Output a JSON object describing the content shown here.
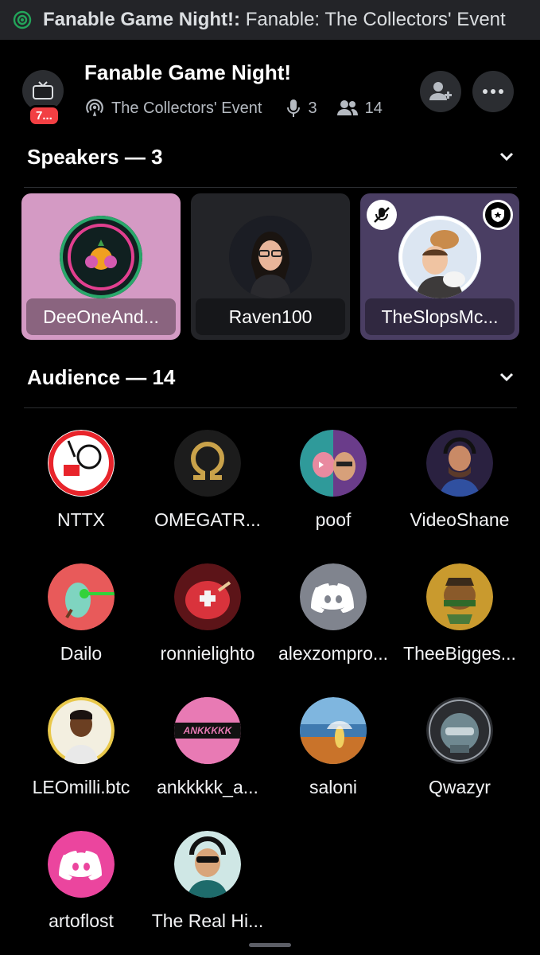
{
  "status_bar": {
    "bold_part": "Fanable Game Night!:",
    "rest": " Fanable: The Collectors' Event",
    "icon": "stage-broadcast-icon"
  },
  "header": {
    "badge": "7...",
    "title": "Fanable Game Night!",
    "subtitle": "The Collectors' Event",
    "speaker_count": "3",
    "listener_count": "14",
    "invite_icon": "add-person-icon",
    "more_icon": "ellipsis-icon"
  },
  "speakers": {
    "label": "Speakers — 3",
    "items": [
      {
        "name": "DeeOneAnd..."
      },
      {
        "name": "Raven100"
      },
      {
        "name": "TheSlopsMc..."
      }
    ]
  },
  "audience": {
    "label": "Audience — 14",
    "items": [
      {
        "name": "NTTX"
      },
      {
        "name": "OMEGATR..."
      },
      {
        "name": "poof"
      },
      {
        "name": "VideoShane"
      },
      {
        "name": "Dailo"
      },
      {
        "name": "ronnielighto"
      },
      {
        "name": "alexzompro..."
      },
      {
        "name": "TheeBigges..."
      },
      {
        "name": "LEOmilli.btc"
      },
      {
        "name": "ankkkkk_a..."
      },
      {
        "name": "saloni"
      },
      {
        "name": "Qwazyr"
      },
      {
        "name": "artoflost"
      },
      {
        "name": "The Real Hi..."
      }
    ],
    "avatar_text_9": "ANKKKKK"
  },
  "colors": {
    "accent_green": "#23a55a",
    "discord_blurple_gray": "#80848e",
    "discord_pink": "#eb459e",
    "speaker_card_1": "#d49ac4",
    "speaker_card_2": "#232428",
    "speaker_card_3": "#4a3e63"
  }
}
